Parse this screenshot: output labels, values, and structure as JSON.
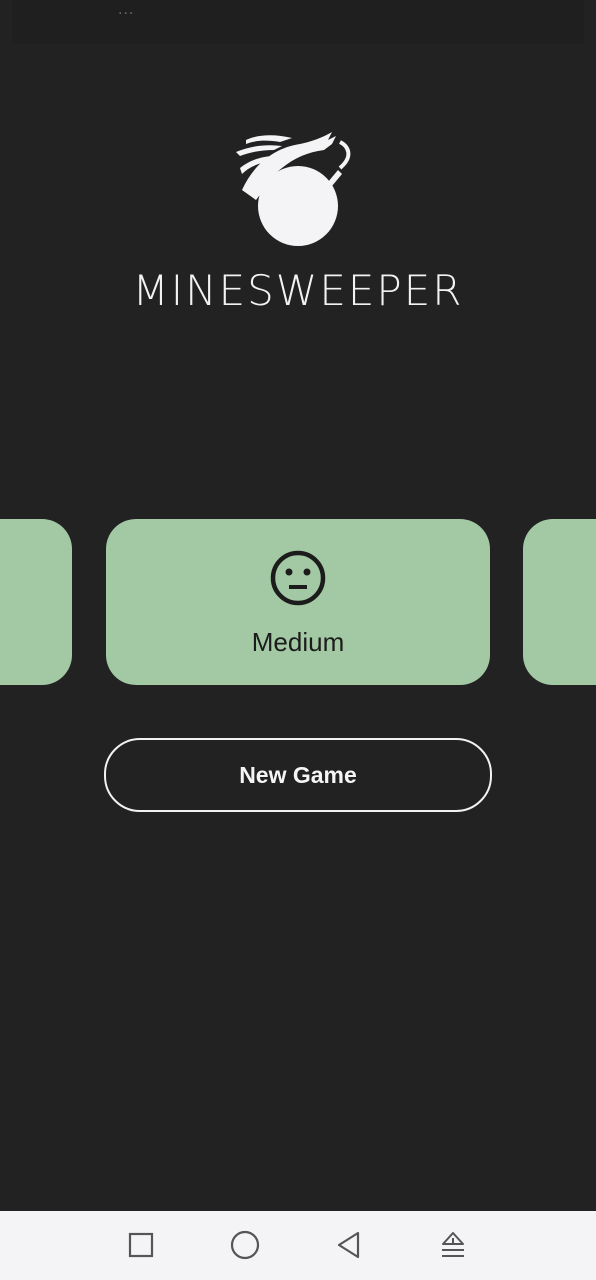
{
  "status_bar": {
    "indicator": "···"
  },
  "app": {
    "title": "MINESWEEPER",
    "logo_icon": "bomb-icon"
  },
  "difficulty_carousel": {
    "selected_label": "Medium",
    "selected_icon": "neutral-face-icon",
    "accent_color": "#a2c9a4"
  },
  "actions": {
    "new_game_label": "New Game"
  },
  "nav_bar": {
    "icons": [
      "square-recents-icon",
      "circle-home-icon",
      "triangle-back-icon",
      "eject-icon"
    ]
  },
  "colors": {
    "background": "#222222",
    "text": "#f2f2f2",
    "nav_background": "#f4f4f6"
  }
}
